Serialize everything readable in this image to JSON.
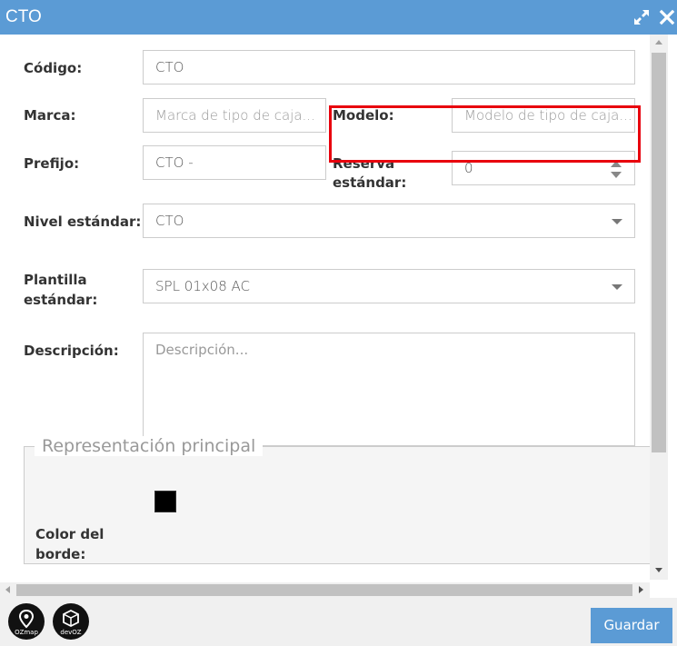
{
  "window": {
    "title": "CTO",
    "expand_icon": "expand-arrows-icon",
    "close_icon": "close-icon",
    "accent_color": "#5b9bd5"
  },
  "form": {
    "codigo": {
      "label": "Código:",
      "value": "CTO"
    },
    "marca": {
      "label": "Marca:",
      "placeholder": "Marca de tipo de caja..."
    },
    "modelo": {
      "label": "Modelo:",
      "placeholder": "Modelo de tipo de caja..."
    },
    "prefijo": {
      "label": "Prefijo:",
      "value": "CTO -"
    },
    "reserva": {
      "label_line1": "Reserva",
      "label_line2": "estándar:",
      "value": "0"
    },
    "nivel": {
      "label": "Nivel estándar:",
      "value": "CTO"
    },
    "plantilla": {
      "label_line1": "Plantilla",
      "label_line2": "estándar:",
      "value": "SPL 01x08 AC"
    },
    "descripcion": {
      "label": "Descripción:",
      "placeholder": "Descripción..."
    }
  },
  "representacion": {
    "legend": "Representación principal",
    "color_borde_line1": "Color del",
    "color_borde_line2": "borde:",
    "color_value": "#000000"
  },
  "highlight_color": "#e8000d",
  "footer": {
    "logo1_text": "OZmap",
    "logo2_text": "devOZ",
    "save_label": "Guardar"
  }
}
